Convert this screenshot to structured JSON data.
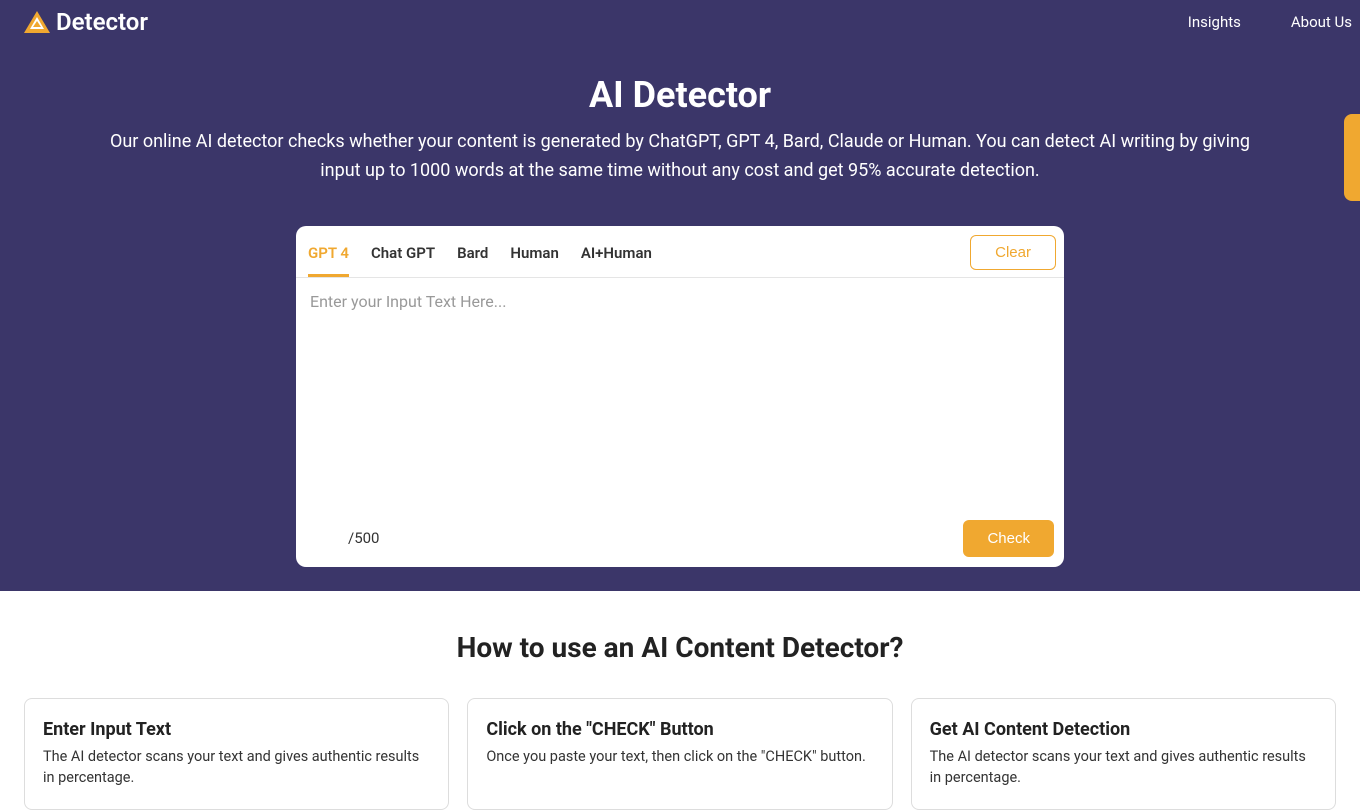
{
  "header": {
    "brand": "Detector",
    "nav": {
      "insights": "Insights",
      "about": "About Us"
    }
  },
  "hero": {
    "title": "AI Detector",
    "description": "Our online AI detector checks whether your content is generated by ChatGPT, GPT 4, Bard, Claude or Human. You can detect AI writing by giving input up to 1000 words at the same time without any cost and get 95% accurate detection."
  },
  "detector": {
    "tabs": {
      "gpt4": "GPT 4",
      "chatgpt": "Chat GPT",
      "bard": "Bard",
      "human": "Human",
      "aihuman": "AI+Human"
    },
    "clear_label": "Clear",
    "placeholder": "Enter your Input Text Here...",
    "counter": " /500",
    "check_label": "Check"
  },
  "howto": {
    "title": "How to use an AI Content Detector?",
    "cards": [
      {
        "title": "Enter Input Text",
        "desc": "The AI detector scans your text and gives authentic results in percentage."
      },
      {
        "title": "Click on the \"CHECK\" Button",
        "desc": "Once you paste your text, then click on the \"CHECK\" button."
      },
      {
        "title": "Get AI Content Detection",
        "desc": "The AI detector scans your text and gives authentic results in percentage."
      }
    ]
  }
}
